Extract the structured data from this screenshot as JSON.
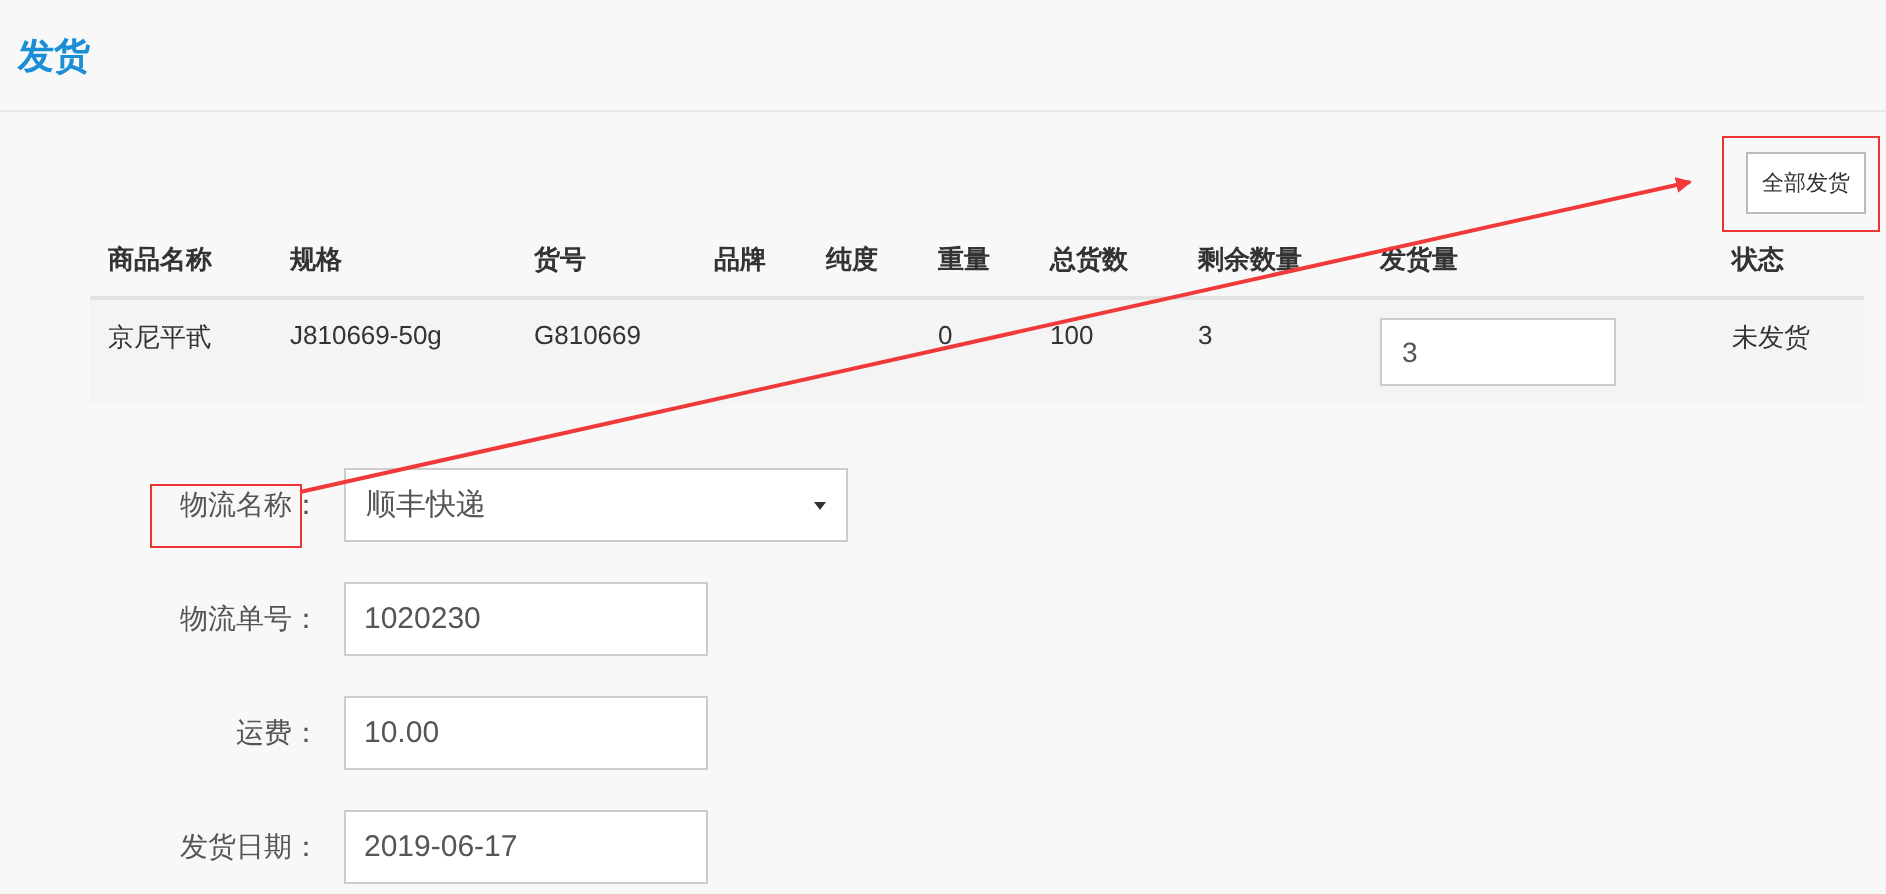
{
  "page_title": "发货",
  "ship_all_button": "全部发货",
  "table": {
    "columns": [
      "商品名称",
      "规格",
      "货号",
      "品牌",
      "纯度",
      "重量",
      "总货数",
      "剩余数量",
      "发货量",
      "状态"
    ],
    "rows": [
      {
        "cells": [
          "京尼平甙",
          "J810669-50g",
          "G810669",
          "",
          "",
          "0",
          "100",
          "3"
        ],
        "ship_quantity": "3",
        "status": "未发货"
      }
    ]
  },
  "form": [
    {
      "kind": "select",
      "label": "物流名称：",
      "value": "顺丰快递"
    },
    {
      "kind": "input",
      "label": "物流单号：",
      "value": "1020230"
    },
    {
      "kind": "input",
      "label": "运费：",
      "value": "10.00"
    },
    {
      "kind": "input",
      "label": "发货日期：",
      "value": "2019-06-17"
    }
  ]
}
